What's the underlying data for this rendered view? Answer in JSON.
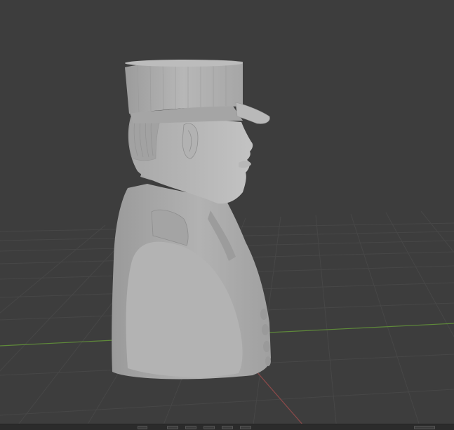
{
  "app": {
    "name": "3D Viewport"
  },
  "viewport": {
    "background_color": "#3d3d3d",
    "grid_color": "#4a4a4a",
    "x_axis_color": "#8c4a4a",
    "y_axis_color": "#5f8a3a"
  },
  "model": {
    "subject": "bust-with-kepi",
    "material_color": "#a9a9a9"
  },
  "bottom_bar": {
    "icons": [
      "mode-icon",
      "previous-icon",
      "play-reverse-icon",
      "play-icon",
      "next-icon",
      "jump-end-icon"
    ]
  }
}
